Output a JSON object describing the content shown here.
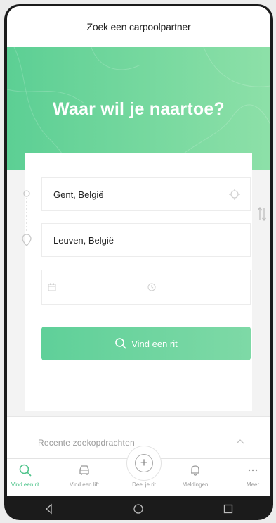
{
  "header": {
    "title": "Zoek een carpoolpartner"
  },
  "hero": {
    "title": "Waar wil je naartoe?"
  },
  "form": {
    "from_value": "Gent, België",
    "to_value": "Leuven, België"
  },
  "search_button": {
    "label": "Vind een rit"
  },
  "recent": {
    "label": "Recente zoekopdrachten"
  },
  "tabs": [
    {
      "label": "Vind een rit",
      "icon": "search-icon",
      "active": true
    },
    {
      "label": "Vind een lift",
      "icon": "car-icon",
      "active": false
    },
    {
      "label": "Deel je rit",
      "icon": "plus-circle-icon",
      "active": false
    },
    {
      "label": "Meldingen",
      "icon": "bell-icon",
      "active": false
    },
    {
      "label": "Meer",
      "icon": "more-icon",
      "active": false
    }
  ],
  "colors": {
    "accent": "#5ccf94",
    "accent_light": "#8de0a8",
    "muted": "#9a9a9a"
  }
}
